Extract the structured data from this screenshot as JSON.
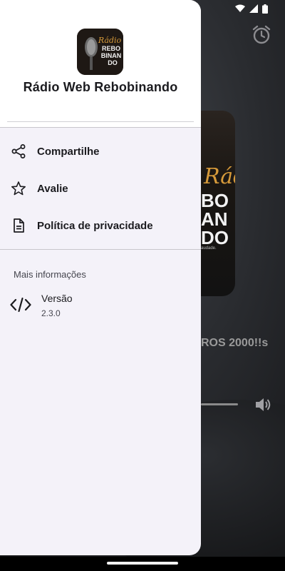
{
  "app": {
    "title": "Rádio Web Rebobinando",
    "logo_text": [
      "Rádio",
      "REBO",
      "BINAN",
      "DO"
    ]
  },
  "drawer": {
    "menu": [
      {
        "label": "Compartilhe",
        "icon": "share-icon"
      },
      {
        "label": "Avalie",
        "icon": "star-icon"
      },
      {
        "label": "Política de privacidade",
        "icon": "document-icon"
      }
    ],
    "more_info": {
      "section_title": "Mais informações",
      "version_label": "Versão",
      "version_value": "2.3.0",
      "icon": "code-icon"
    }
  },
  "background": {
    "art_script": "Rádio",
    "art_lines": [
      "BO",
      "AN",
      "DO"
    ],
    "art_small": "audade.",
    "song_title": "ROS 2000!!s",
    "icons": [
      "alarm-icon",
      "volume-icon",
      "wifi-icon",
      "signal-icon",
      "battery-icon"
    ]
  },
  "colors": {
    "drawer_bg": "#f4f2f9",
    "header_bg": "#ffffff",
    "text_primary": "#1b1b1f",
    "accent_logo": "#d69a3a"
  }
}
